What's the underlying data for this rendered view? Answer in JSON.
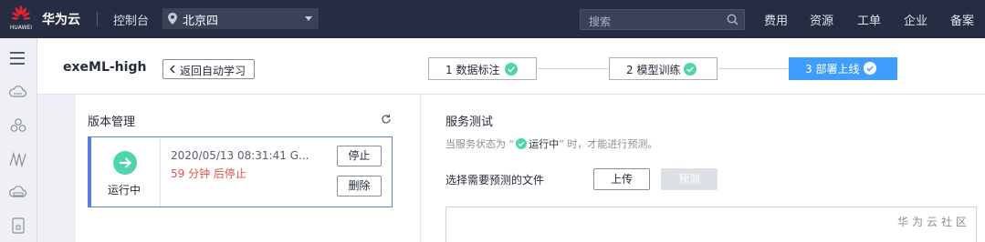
{
  "brand": {
    "logo_text": "HUAWEI",
    "name": "华为云"
  },
  "topbar": {
    "console": "控制台",
    "region": "北京四",
    "search_placeholder": "搜索",
    "nav": [
      "费用",
      "资源",
      "工单",
      "企业",
      "备案"
    ]
  },
  "project": {
    "title": "exeML-high",
    "back_label": "返回自动学习"
  },
  "steps": [
    {
      "label": "1 数据标注",
      "state": "done"
    },
    {
      "label": "2 模型训练",
      "state": "done"
    },
    {
      "label": "3 部署上线",
      "state": "active"
    }
  ],
  "version_panel": {
    "title": "版本管理",
    "status": "运行中",
    "time": "2020/05/13 08:31:41 G...",
    "auto_stop": "59 分钟 后停止",
    "stop_label": "停止",
    "delete_label": "删除"
  },
  "service_test": {
    "title": "服务测试",
    "hint_prefix": "当服务状态为 “",
    "hint_status": "运行中",
    "hint_suffix": "” 时，才能进行预测。",
    "file_label": "选择需要预测的文件",
    "upload_label": "上传",
    "predict_label": "预测"
  },
  "watermark": "华为云社区",
  "colors": {
    "topbar": "#262d43",
    "accent": "#5e7ce0",
    "step_active": "#409eff",
    "success": "#50d4ab",
    "warning_text": "#e3524b"
  },
  "icons": {
    "menu": "hamburger-icon",
    "rail": [
      "cloud-icon",
      "cluster-icon",
      "model-icon",
      "server-icon",
      "device-icon"
    ]
  }
}
